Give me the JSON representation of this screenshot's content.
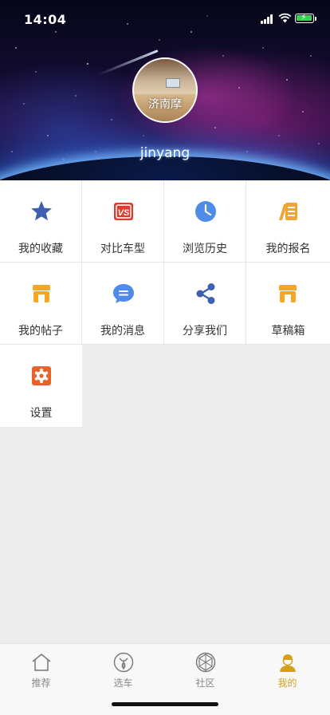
{
  "status_bar": {
    "time": "14:04"
  },
  "profile": {
    "avatar_caption": "济南摩",
    "username": "jinyang"
  },
  "menu": {
    "items": [
      {
        "label": "我的收藏",
        "icon": "star-icon",
        "color": "#3f5fb0"
      },
      {
        "label": "对比车型",
        "icon": "vs-icon",
        "color": "#e03a2c"
      },
      {
        "label": "浏览历史",
        "icon": "clock-icon",
        "color": "#4f8be8"
      },
      {
        "label": "我的报名",
        "icon": "signup-icon",
        "color": "#f0a530"
      },
      {
        "label": "我的帖子",
        "icon": "shop-icon",
        "color": "#f5a623"
      },
      {
        "label": "我的消息",
        "icon": "message-icon",
        "color": "#4f8be8"
      },
      {
        "label": "分享我们",
        "icon": "share-icon",
        "color": "#3f5fb0"
      },
      {
        "label": "草稿箱",
        "icon": "draft-icon",
        "color": "#f5a623"
      },
      {
        "label": "设置",
        "icon": "gear-icon",
        "color": "#e8632c"
      }
    ]
  },
  "tabbar": {
    "active_color": "#d4a017",
    "tabs": [
      {
        "label": "推荐",
        "icon": "home-icon"
      },
      {
        "label": "选车",
        "icon": "motorcycle-icon"
      },
      {
        "label": "社区",
        "icon": "community-icon"
      },
      {
        "label": "我的",
        "icon": "profile-icon",
        "active": true
      }
    ]
  }
}
